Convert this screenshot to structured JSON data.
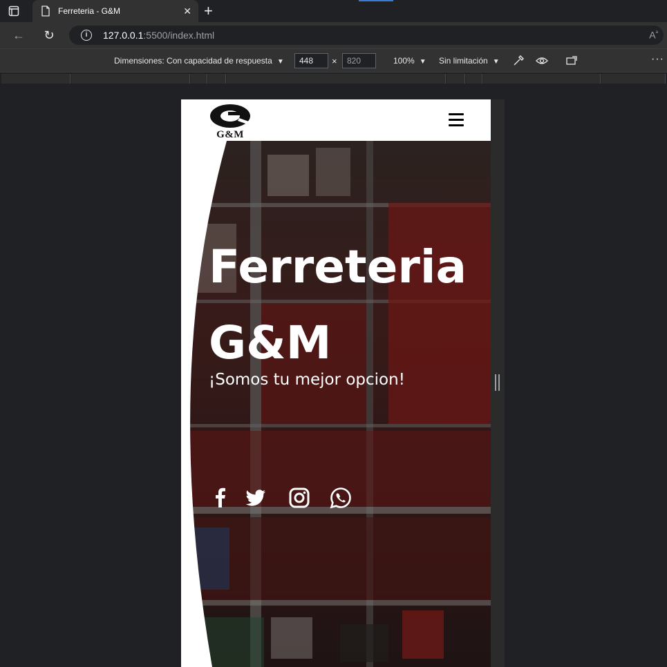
{
  "browser": {
    "tab_title": "Ferreteria - G&M",
    "url_host": "127.0.0.1",
    "url_path": ":5500/index.html"
  },
  "devtools": {
    "dimensions_label": "Dimensiones: Con capacidad de respuesta",
    "width": "448",
    "height": "820",
    "zoom": "100%",
    "throttling": "Sin limitación"
  },
  "site": {
    "logo_text": "G&M",
    "hero": {
      "title_line1": "Ferreteria",
      "title_line2": "G&M",
      "subtitle": "¡Somos tu mejor opcion!"
    },
    "socials": [
      "facebook-icon",
      "twitter-icon",
      "instagram-icon",
      "whatsapp-icon"
    ]
  }
}
